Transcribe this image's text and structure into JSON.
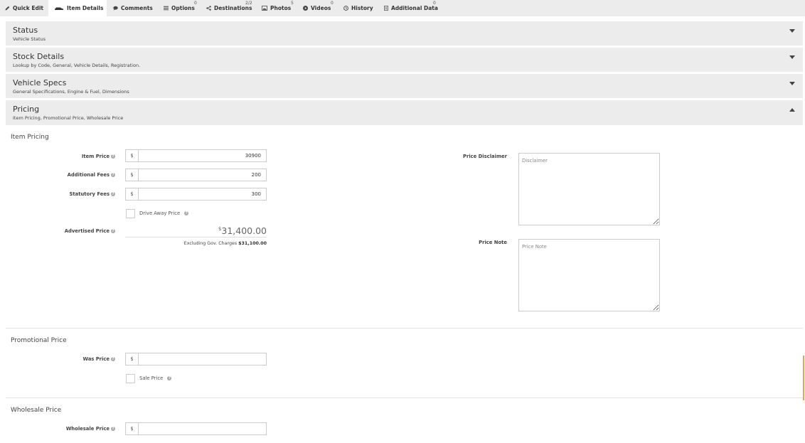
{
  "tabs": [
    {
      "label": "Quick Edit",
      "icon": "edit-icon",
      "badge": ""
    },
    {
      "label": "Item Details",
      "icon": "car-icon",
      "badge": ""
    },
    {
      "label": "Comments",
      "icon": "comment-icon",
      "badge": ""
    },
    {
      "label": "Options",
      "icon": "list-icon",
      "badge": "0"
    },
    {
      "label": "Destinations",
      "icon": "share-icon",
      "badge": "2/2"
    },
    {
      "label": "Photos",
      "icon": "image-icon",
      "badge": "5"
    },
    {
      "label": "Videos",
      "icon": "play-icon",
      "badge": "0"
    },
    {
      "label": "History",
      "icon": "clock-icon",
      "badge": ""
    },
    {
      "label": "Additional Data",
      "icon": "data-icon",
      "badge": "0"
    }
  ],
  "panels": [
    {
      "title": "Status",
      "subtitle": "Vehicle Status",
      "expanded": false
    },
    {
      "title": "Stock Details",
      "subtitle": "Lookup by Code, General, Vehicle Details, Registration.",
      "expanded": false
    },
    {
      "title": "Vehicle Specs",
      "subtitle": "General Specifications, Engine & Fuel, Dimensions",
      "expanded": false
    },
    {
      "title": "Pricing",
      "subtitle": "Item Pricing, Promotional Price, Wholesale Price",
      "expanded": true
    }
  ],
  "item_pricing": {
    "heading": "Item Pricing",
    "currency": "$",
    "item_price_label": "Item Price",
    "item_price": "30900",
    "additional_fees_label": "Additional Fees",
    "additional_fees": "200",
    "statutory_fees_label": "Statutory Fees",
    "statutory_fees": "300",
    "drive_away_label": "Drive Away Price",
    "advertised_label": "Advertised Price",
    "advertised_symbol": "$",
    "advertised_value": "31,400.00",
    "excluding_text": "Excluding Gov. Charges",
    "excluding_value": "$31,100.00",
    "disclaimer_label": "Price Disclaimer",
    "disclaimer_placeholder": "Disclaimer",
    "note_label": "Price Note",
    "note_placeholder": "Price Note"
  },
  "promotional": {
    "heading": "Promotional Price",
    "was_price_label": "Was Price",
    "was_price": "",
    "sale_price_label": "Sale Price"
  },
  "wholesale": {
    "heading": "Wholesale Price",
    "wholesale_price_label": "Wholesale Price",
    "wholesale_price": ""
  },
  "colors": {
    "accent": "#f0a050",
    "panel_bg": "#ececec"
  }
}
